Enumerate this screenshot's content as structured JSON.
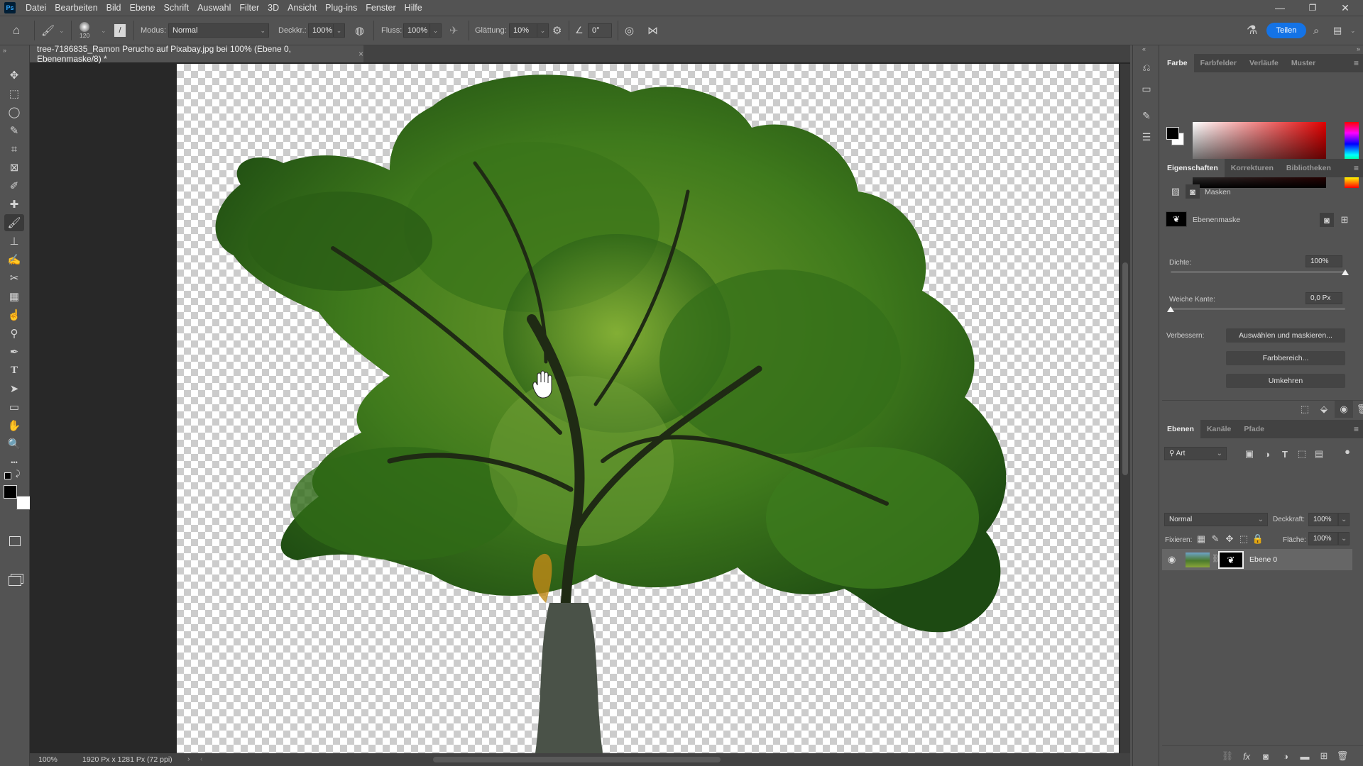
{
  "app": {
    "logo": "Ps",
    "menu": [
      "Datei",
      "Bearbeiten",
      "Bild",
      "Ebene",
      "Schrift",
      "Auswahl",
      "Filter",
      "3D",
      "Ansicht",
      "Plug-ins",
      "Fenster",
      "Hilfe"
    ],
    "window_controls": {
      "minimize": "—",
      "restore": "❐",
      "close": "✕"
    }
  },
  "options_bar": {
    "brush_size": "120",
    "mode_label": "Modus:",
    "mode_value": "Normal",
    "opacity_label": "Deckkr.:",
    "opacity_value": "100%",
    "flow_label": "Fluss:",
    "flow_value": "100%",
    "smoothing_label": "Glättung:",
    "smoothing_value": "10%",
    "angle_value": "0°",
    "share_label": "Teilen"
  },
  "document": {
    "tab_title": "tree-7186835_Ramon Perucho auf Pixabay.jpg bei 100% (Ebene 0, Ebenenmaske/8) *",
    "close_glyph": "×",
    "zoom": "100%",
    "doc_info": "1920 Px x 1281 Px (72 ppi)"
  },
  "tools": [
    {
      "name": "move-tool",
      "glyph": "✥"
    },
    {
      "name": "marquee-tool",
      "glyph": "⬚"
    },
    {
      "name": "lasso-tool",
      "glyph": "◯"
    },
    {
      "name": "quick-selection-tool",
      "glyph": "✎"
    },
    {
      "name": "crop-tool",
      "glyph": "⌗"
    },
    {
      "name": "frame-tool",
      "glyph": "⊠"
    },
    {
      "name": "eyedropper-tool",
      "glyph": "✐"
    },
    {
      "name": "healing-brush-tool",
      "glyph": "✚"
    },
    {
      "name": "brush-tool",
      "glyph": "🖌"
    },
    {
      "name": "clone-stamp-tool",
      "glyph": "⊥"
    },
    {
      "name": "history-brush-tool",
      "glyph": "✍"
    },
    {
      "name": "eraser-tool",
      "glyph": "✂"
    },
    {
      "name": "gradient-tool",
      "glyph": "▦"
    },
    {
      "name": "smudge-tool",
      "glyph": "☝"
    },
    {
      "name": "dodge-tool",
      "glyph": "⚲"
    },
    {
      "name": "pen-tool",
      "glyph": "✒"
    },
    {
      "name": "type-tool",
      "glyph": "T"
    },
    {
      "name": "path-selection-tool",
      "glyph": "➤"
    },
    {
      "name": "rectangle-tool",
      "glyph": "▭"
    },
    {
      "name": "hand-tool",
      "glyph": "✋"
    },
    {
      "name": "zoom-tool",
      "glyph": "🔍"
    },
    {
      "name": "more-tools",
      "glyph": "•••"
    }
  ],
  "color_panel": {
    "tabs": [
      "Farbe",
      "Farbfelder",
      "Verläufe",
      "Muster"
    ],
    "active_tab": "Farbe",
    "foreground": "#000000",
    "background": "#ffffff",
    "hue": "#ff0000"
  },
  "properties_panel": {
    "tabs": [
      "Eigenschaften",
      "Korrekturen",
      "Bibliotheken"
    ],
    "active_tab": "Eigenschaften",
    "section": "Masken",
    "mask_type": "Ebenenmaske",
    "density_label": "Dichte:",
    "density_value": "100%",
    "density_fraction": 1.0,
    "feather_label": "Weiche Kante:",
    "feather_value": "0,0 Px",
    "feather_fraction": 0.0,
    "refine_label": "Verbessern:",
    "buttons": [
      "Auswählen und maskieren...",
      "Farbbereich...",
      "Umkehren"
    ]
  },
  "layers_panel": {
    "tabs": [
      "Ebenen",
      "Kanäle",
      "Pfade"
    ],
    "active_tab": "Ebenen",
    "filter_label": "Art",
    "blend_mode": "Normal",
    "opacity_label": "Deckkraft:",
    "opacity_value": "100%",
    "lock_label": "Fixieren:",
    "fill_label": "Fläche:",
    "fill_value": "100%",
    "layers": [
      {
        "name": "Ebene 0",
        "visible": true,
        "has_mask": true
      }
    ]
  },
  "colors": {
    "accent": "#1473e6",
    "ui_bg": "#535353",
    "ui_dark": "#282828"
  }
}
